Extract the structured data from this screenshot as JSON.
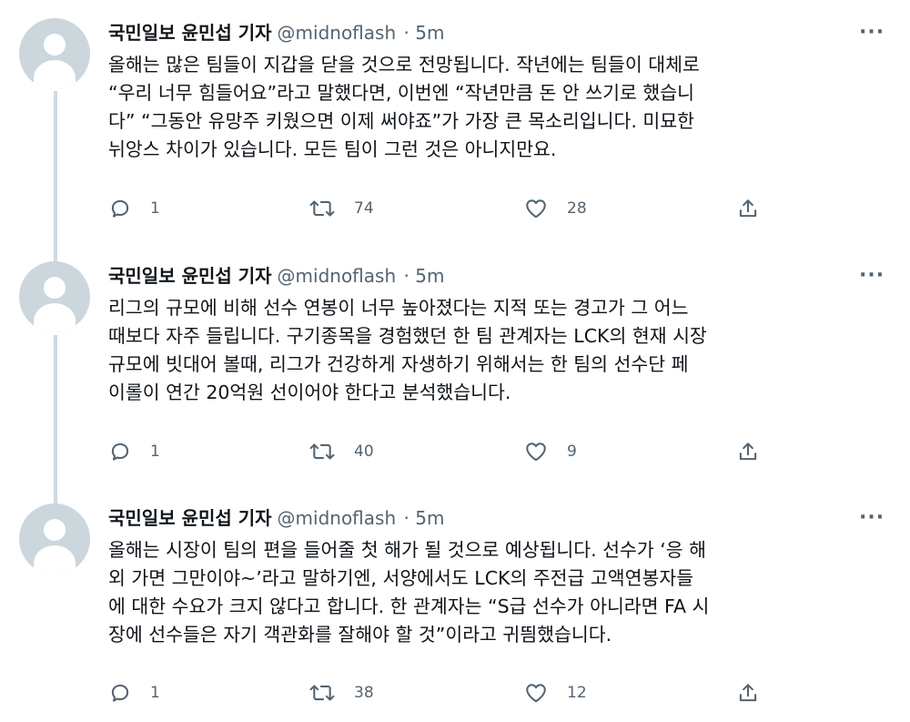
{
  "tweets": [
    {
      "name": "국민일보 윤민섭 기자",
      "handle": "@midnoflash",
      "time": "· 5m",
      "more_label": "···",
      "lines": [
        "올해는 많은 팀들이 지갑을 닫을 것으로 전망됩니다. 작년에는 팀들이 대체로",
        "“우리 너무 힘들어요”라고 말했다면, 이번엔 “작년만큼 돈 안 쓰기로 했습니",
        "다” “그동안 유망주 키웠으면 이제 써야죠”가 가장 큰 목소리입니다. 미묘한",
        "뉘앙스 차이가 있습니다. 모든 팀이 그런 것은 아니지만요."
      ],
      "replies": "1",
      "retweets": "74",
      "likes": "28"
    },
    {
      "name": "국민일보 윤민섭 기자",
      "handle": "@midnoflash",
      "time": "· 5m",
      "more_label": "···",
      "lines": [
        "리그의 규모에 비해 선수 연봉이 너무 높아졌다는 지적 또는 경고가 그 어느",
        "때보다 자주 들립니다. 구기종목을 경험했던 한 팀 관계자는 LCK의 현재 시장",
        "규모에 빗대어 볼때, 리그가 건강하게 자생하기 위해서는 한 팀의 선수단 페",
        "이롤이 연간 20억원 선이어야 한다고 분석했습니다."
      ],
      "replies": "1",
      "retweets": "40",
      "likes": "9"
    },
    {
      "name": "국민일보 윤민섭 기자",
      "handle": "@midnoflash",
      "time": "· 5m",
      "more_label": "···",
      "lines": [
        "올해는 시장이 팀의 편을 들어줄 첫 해가 될 것으로 예상됩니다. 선수가 ‘응 해",
        "외 가면 그만이야~’라고 말하기엔, 서양에서도 LCK의 주전급 고액연봉자들",
        "에 대한 수요가 크지 않다고 합니다. 한 관계자는 “S급 선수가 아니라면 FA 시",
        "장에 선수들은 자기 객관화를 잘해야 할 것”이라고 귀띔했습니다."
      ],
      "replies": "1",
      "retweets": "38",
      "likes": "12"
    }
  ],
  "icons": {
    "reply": "reply-icon",
    "retweet": "retweet-icon",
    "like": "heart-icon",
    "share": "share-icon",
    "more": "more-icon",
    "avatar": "default-avatar-icon"
  },
  "colors": {
    "text": "#0f1419",
    "muted": "#536471",
    "thread_line": "#cfd9de",
    "avatar_bg": "#ccd6dd"
  }
}
